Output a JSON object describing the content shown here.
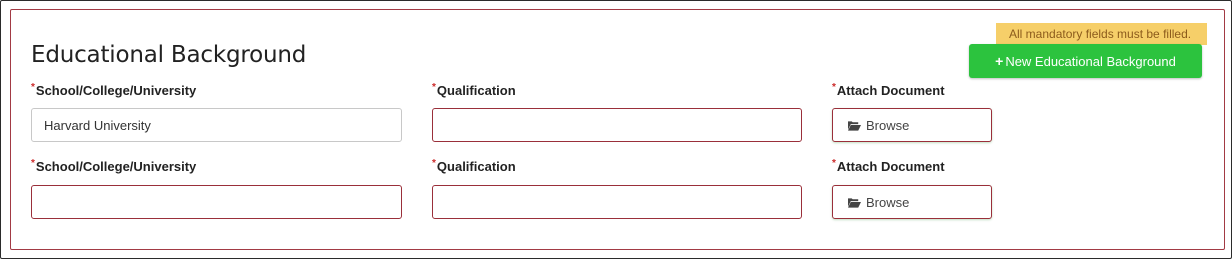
{
  "section": {
    "title": "Educational Background",
    "alert": "All mandatory fields must be filled.",
    "new_button": "New Educational Background",
    "required_mark": "*"
  },
  "rows": [
    {
      "school_label": "School/College/University",
      "school_value": "Harvard University",
      "qualification_label": "Qualification",
      "qualification_value": "",
      "attach_label": "Attach Document",
      "browse_label": "Browse"
    },
    {
      "school_label": "School/College/University",
      "school_value": "",
      "qualification_label": "Qualification",
      "qualification_value": "",
      "attach_label": "Attach Document",
      "browse_label": "Browse"
    }
  ],
  "colors": {
    "panel_border": "#a23a44",
    "alert_bg": "#f6cf69",
    "alert_text": "#8c5b1c",
    "primary_button": "#2cc33e",
    "required": "#cc2a2a"
  },
  "icons": {
    "new_button": "plus-icon",
    "browse": "folder-open-icon"
  }
}
